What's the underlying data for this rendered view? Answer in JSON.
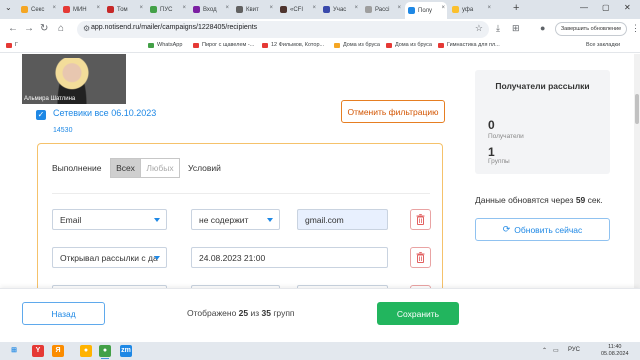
{
  "browser": {
    "tabs": [
      {
        "label": "Секс",
        "color": "#f5a623"
      },
      {
        "label": "МИН",
        "color": "#e53935"
      },
      {
        "label": "Том",
        "color": "#c62828"
      },
      {
        "label": "ПУС",
        "color": "#43a047"
      },
      {
        "label": "Вход",
        "color": "#7b1fa2"
      },
      {
        "label": "Квит",
        "color": "#616161"
      },
      {
        "label": "«СFI",
        "color": "#4e342e"
      },
      {
        "label": "Учас",
        "color": "#3949ab"
      },
      {
        "label": "Рассі",
        "color": "#9e9e9e"
      },
      {
        "label": "Полу",
        "color": "#1e88e5"
      },
      {
        "label": "уфа",
        "color": "#fbc02d"
      }
    ],
    "tab_close_glyph": "×",
    "new_tab_glyph": "+",
    "window_controls": [
      "⌄",
      "—",
      "▢",
      "✕"
    ],
    "nav": {
      "back": "←",
      "forward": "→",
      "reload": "↻",
      "home": "⌂"
    },
    "url": "app.notisend.ru/mailer/campaigns/1228405/recipients",
    "tune_glyph": "⚙",
    "star_glyph": "☆",
    "ext_glyphs": [
      "⤓",
      "⊞",
      "⋮"
    ],
    "update_label": "Завершить обновление"
  },
  "bookmarks": [
    {
      "label": "Г",
      "color": "#e53935"
    },
    {
      "label": "WhatsApp",
      "color": "#43a047"
    },
    {
      "label": "Пирог с щавелем -...",
      "color": "#e53935"
    },
    {
      "label": "12 Фильмов, Котор...",
      "color": "#e53935"
    },
    {
      "label": "Дома из бруса",
      "color": "#f5a623"
    },
    {
      "label": "Дома из бруса",
      "color": "#e53935"
    },
    {
      "label": "Гимнастика для пл...",
      "color": "#e53935"
    }
  ],
  "bookmarks_all": "Все закладки",
  "video": {
    "name": "Альмира Шатлина"
  },
  "segment": {
    "checkbox_glyph": "✓",
    "title": "Сетевики все 06.10.2023",
    "id": "14530",
    "reset_label": "Отменить фильтрацию"
  },
  "filter": {
    "exec_label": "Выполнение",
    "all_label": "Всех",
    "any_label": "Любых",
    "conditions_label": "Условий",
    "rows": [
      {
        "field": "Email",
        "operator": "не содержит",
        "value": "gmail.com",
        "value_highlight": true
      },
      {
        "field": "Открывал рассылки с да",
        "operator": null,
        "value": "24.08.2023 21:00",
        "value_highlight": false
      },
      {
        "field": "",
        "operator": "",
        "value": "",
        "value_highlight": false
      }
    ]
  },
  "recipients": {
    "title": "Получатели рассылки",
    "recipients_count": "0",
    "recipients_label": "Получатели",
    "groups_count": "1",
    "groups_label": "Группы",
    "update_note_prefix": "Данные обновятся через ",
    "update_seconds": "59",
    "update_note_suffix": " сек.",
    "refresh_glyph": "⟳",
    "refresh_label": "Обновить сейчас"
  },
  "footer": {
    "back_label": "Назад",
    "shown_prefix": "Отображено ",
    "shown_count": "25",
    "shown_middle": " из ",
    "shown_total": "35",
    "shown_suffix": " групп",
    "save_label": "Сохранить"
  },
  "taskbar": {
    "apps": [
      {
        "label": "Y",
        "color": "#e53935"
      },
      {
        "label": "Я",
        "color": "#fb8c00"
      },
      {
        "label": "●",
        "color": "#ffb300"
      },
      {
        "label": "●",
        "color": "#43a047"
      },
      {
        "label": "zm",
        "color": "#1e88e5"
      }
    ],
    "tray_lang": "РУС",
    "time": "11:40",
    "date": "05.08.2024"
  }
}
